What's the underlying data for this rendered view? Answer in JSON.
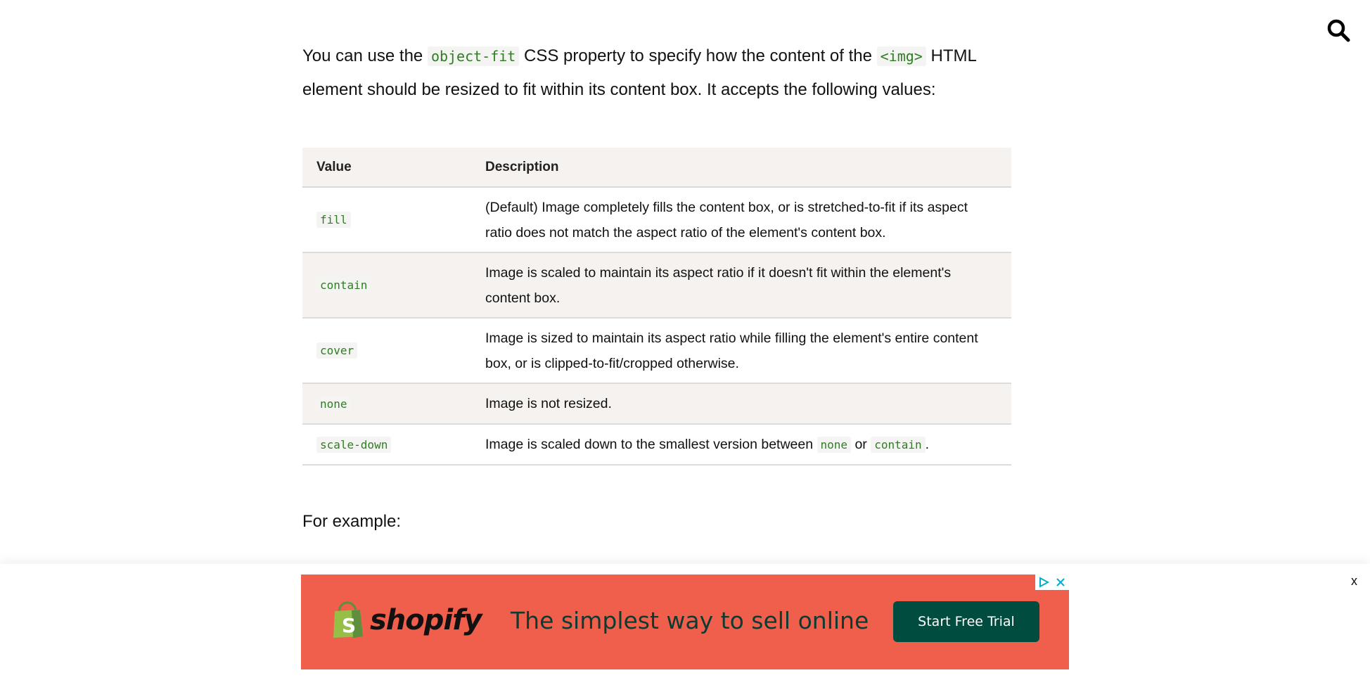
{
  "header": {
    "search_icon": "search-icon"
  },
  "intro": {
    "part1": "You can use the ",
    "code1": "object-fit",
    "part2": " CSS property to specify how the content of the ",
    "code2": "<img>",
    "part3": " HTML element should be resized to fit within its content box. It accepts the following values:"
  },
  "table": {
    "headers": [
      "Value",
      "Description"
    ],
    "rows": [
      {
        "value": "fill",
        "description": "(Default) Image completely fills the content box, or is stretched-to-fit if its aspect ratio does not match the aspect ratio of the element's content box."
      },
      {
        "value": "contain",
        "description": "Image is scaled to maintain its aspect ratio if it doesn't fit within the element's content box."
      },
      {
        "value": "cover",
        "description": "Image is sized to maintain its aspect ratio while filling the element's entire content box, or is clipped-to-fit/cropped otherwise."
      },
      {
        "value": "none",
        "description": "Image is not resized."
      },
      {
        "value": "scale-down",
        "desc_part1": "Image is scaled down to the smallest version between ",
        "desc_code1": "none",
        "desc_part2": " or ",
        "desc_code2": "contain",
        "desc_part3": "."
      }
    ]
  },
  "for_example": "For example:",
  "ad": {
    "close_label": "x",
    "brand": "shopify",
    "headline": "The simplest way to sell online",
    "cta": "Start Free Trial",
    "colors": {
      "background": "#ef5f4b",
      "cta": "#004c3f",
      "logo_green": "#95bf47",
      "info_blue": "#00aecd"
    }
  }
}
